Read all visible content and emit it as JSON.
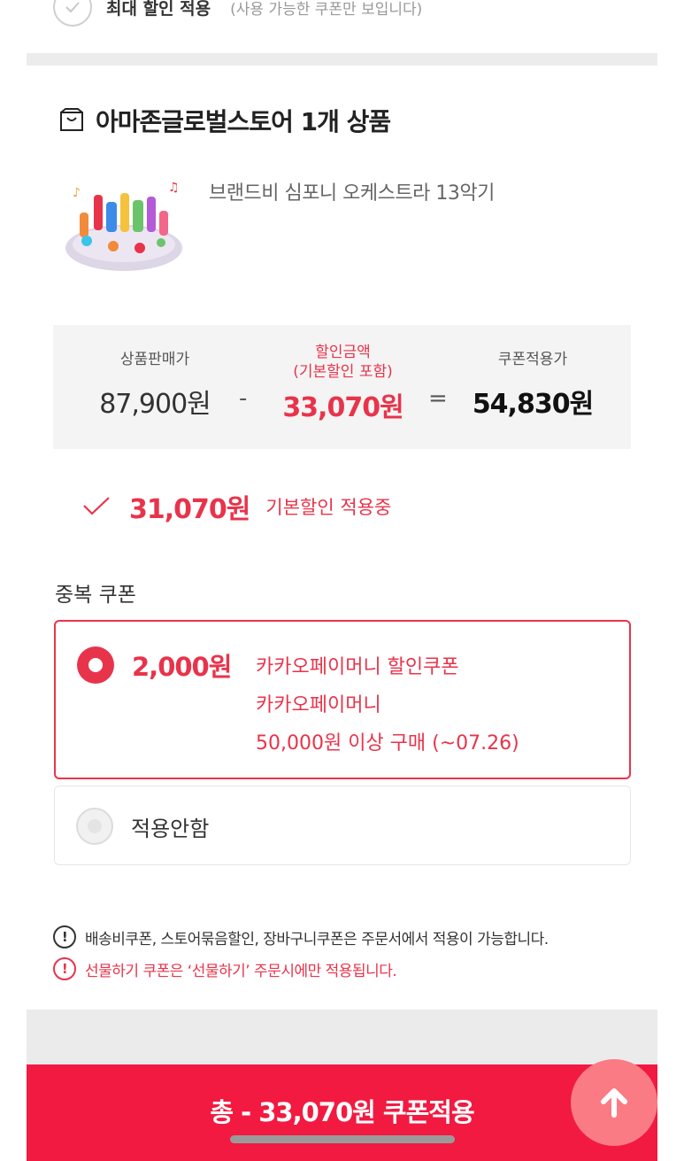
{
  "top_option": {
    "label": "최대 할인 적용",
    "sub": "(사용 가능한 쿠폰만 보입니다)"
  },
  "store": {
    "title": "아마존글로벌스토어 1개 상품"
  },
  "product": {
    "name": "브랜드비 심포니 오케스트라 13악기"
  },
  "price_breakdown": {
    "sale_label": "상품판매가",
    "sale_value": "87,900원",
    "minus": "-",
    "discount_label_1": "할인금액",
    "discount_label_2": "(기본할인 포함)",
    "discount_value": "33,070원",
    "equals": "=",
    "coupon_price_label": "쿠폰적용가",
    "coupon_price_value": "54,830원"
  },
  "basic_discount": {
    "amount": "31,070원",
    "text": "기본할인 적용중"
  },
  "duplicate_coupon": {
    "section_label": "중복 쿠폰",
    "coupons": [
      {
        "amount": "2,000원",
        "name": "카카오페이머니 할인쿠폰",
        "issuer": "카카오페이머니",
        "condition": "50,000원 이상 구매 (~07.26)",
        "selected": true
      }
    ],
    "none_label": "적용안함"
  },
  "notices": [
    "배송비쿠폰, 스토어묶음할인, 장바구니쿠폰은 주문서에서 적용이 가능합니다.",
    "선물하기 쿠폰은 ‘선물하기’ 주문시에만 적용됩니다."
  ],
  "notice_icon": "!",
  "apply_button": {
    "label": "총 - 33,070원 쿠폰적용"
  },
  "colors": {
    "accent": "#e8344b",
    "apply_bar": "#f21a40",
    "scroll_top": "#fb7b85"
  }
}
